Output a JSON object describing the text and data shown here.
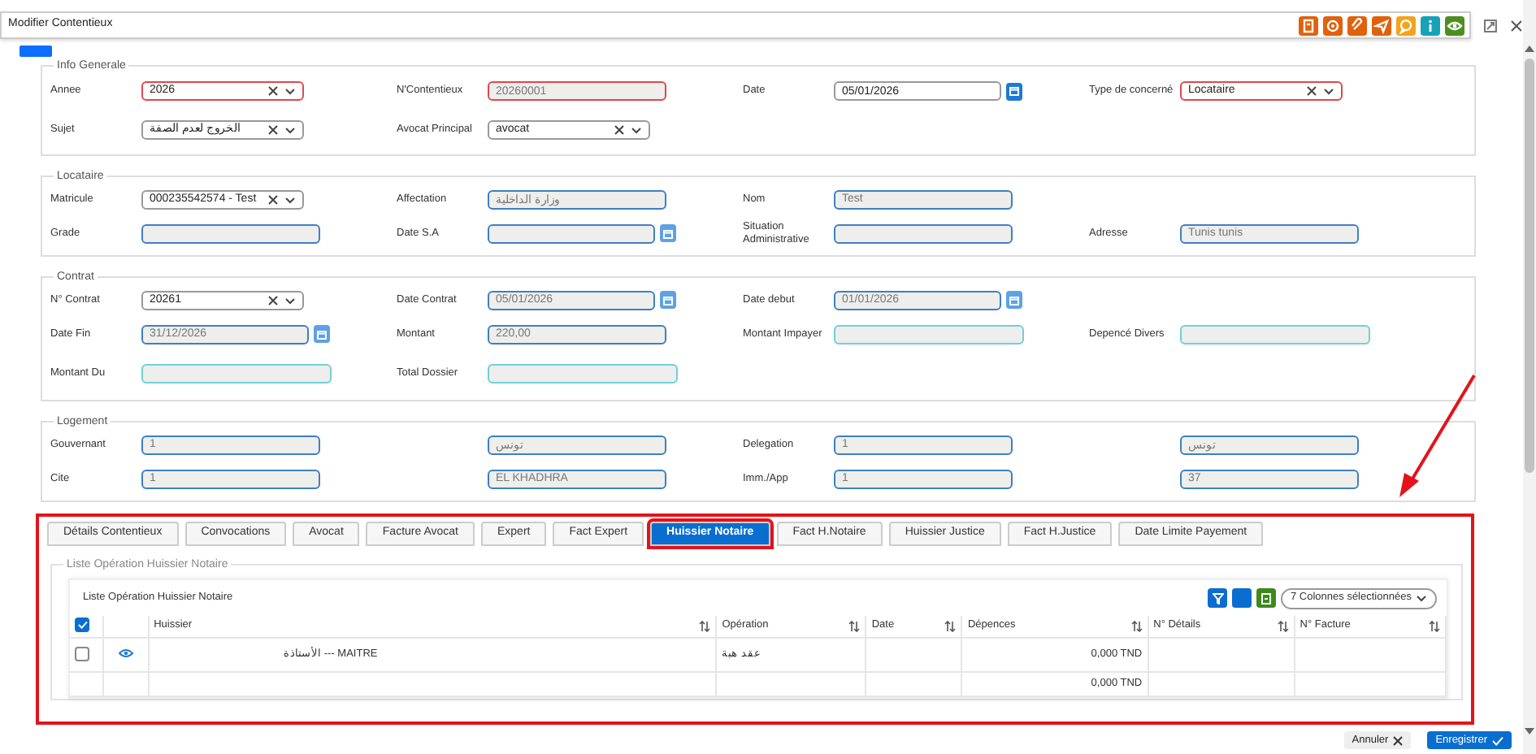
{
  "window": {
    "title": "Modifier Contentieux"
  },
  "sections": [
    {
      "title": "Info Generale",
      "rows": [
        [
          {
            "label": "Annee",
            "kind": "select",
            "value": "2026",
            "invalid": true
          },
          {
            "label": "N'Contentieux",
            "kind": "input",
            "value": "20260001",
            "invalid": true,
            "readonly": true
          },
          {
            "label": "Date",
            "kind": "date",
            "value": "05/01/2026"
          },
          {
            "label": "Type de concerné",
            "kind": "select",
            "value": "Locataire",
            "invalid": true
          }
        ],
        [
          {
            "label": "Sujet",
            "kind": "select",
            "value": "الخروج لعدم الصفة"
          },
          {
            "label": "Avocat Principal",
            "kind": "select",
            "value": "avocat"
          }
        ]
      ]
    },
    {
      "title": "Locataire",
      "rows": [
        [
          {
            "label": "Matricule",
            "kind": "select",
            "value": "000235542574 - Test"
          },
          {
            "label": "Affectation",
            "kind": "input",
            "value": "وزارة الداخلية",
            "readonly": true
          },
          {
            "label": "Nom",
            "kind": "input",
            "value": "Test",
            "readonly": true
          }
        ],
        [
          {
            "label": "Grade",
            "kind": "input",
            "readonly": true
          },
          {
            "label": "Date S.A",
            "kind": "date",
            "readonly": true
          },
          {
            "label": "Situation Administrative",
            "kind": "input",
            "readonly": true
          },
          {
            "label": "Adresse",
            "kind": "input",
            "value": "Tunis tunis",
            "readonly": true
          }
        ]
      ]
    },
    {
      "title": "Contrat",
      "rows": [
        [
          {
            "label": "N° Contrat",
            "kind": "select",
            "value": "20261"
          },
          {
            "label": "Date Contrat",
            "kind": "date",
            "value": "05/01/2026",
            "readonly": true
          },
          {
            "label": "Date debut",
            "kind": "date",
            "value": "01/01/2026",
            "readonly": true
          }
        ],
        [
          {
            "label": "Date Fin",
            "kind": "date",
            "value": "31/12/2026",
            "readonly": true
          },
          {
            "label": "Montant",
            "kind": "input",
            "value": "220,00",
            "readonly": true
          },
          {
            "label": "Montant Impayer",
            "kind": "amount",
            "readonly": true
          },
          {
            "label": "Depencé Divers",
            "kind": "amount",
            "readonly": true
          }
        ],
        [
          {
            "label": "Montant Du",
            "kind": "amount",
            "readonly": true
          },
          {
            "label": "Total Dossier",
            "kind": "amount",
            "readonly": true
          }
        ]
      ]
    },
    {
      "title": "Logement",
      "rows": [
        [
          {
            "label": "Gouvernant",
            "kind": "input",
            "value": "1",
            "readonly": true
          },
          {
            "kind": "input",
            "value": "تونس",
            "readonly": true
          },
          {
            "label": "Delegation",
            "kind": "input",
            "value": "1",
            "readonly": true
          },
          {
            "kind": "input",
            "value": "تونس",
            "readonly": true
          }
        ],
        [
          {
            "label": "Cite",
            "kind": "input",
            "value": "1",
            "readonly": true
          },
          {
            "kind": "input",
            "value": "EL KHADHRA",
            "readonly": true
          },
          {
            "label": "Imm./App",
            "kind": "input",
            "value": "1",
            "readonly": true
          },
          {
            "kind": "input",
            "value": "37",
            "readonly": true
          }
        ]
      ]
    }
  ],
  "panel": {
    "tabs": [
      {
        "label": "Détails Contentieux",
        "selected": false
      },
      {
        "label": "Convocations",
        "selected": false
      },
      {
        "label": "Avocat",
        "selected": false
      },
      {
        "label": "Facture Avocat",
        "selected": false
      },
      {
        "label": "Expert",
        "selected": false
      },
      {
        "label": "Fact Expert",
        "selected": false
      },
      {
        "label": "Huissier Notaire",
        "selected": true
      },
      {
        "label": "Fact H.Notaire",
        "selected": false
      },
      {
        "label": "Huissier Justice",
        "selected": false
      },
      {
        "label": "Fact H.Justice",
        "selected": false
      },
      {
        "label": "Date Limite Payement",
        "selected": false
      }
    ],
    "group_title": "Liste Opération Huissier Notaire",
    "card_title": "Liste Opération Huissier Notaire",
    "column_select": "7 Colonnes sélectionnées",
    "table": {
      "all_checked": true,
      "columns": [
        "Huissier",
        "Opération",
        "Date",
        "Dépences",
        "N° Détails",
        "N° Facture"
      ],
      "rows": [
        {
          "kind": "data",
          "checked": false,
          "cells": [
            "الأستاذة --- MAITRE",
            "عقد هبة",
            "",
            "0,000 TND",
            "",
            ""
          ]
        },
        {
          "kind": "total",
          "cells": [
            "",
            "",
            "",
            "0,000 TND",
            "",
            ""
          ]
        }
      ]
    }
  },
  "footer_buttons": [
    {
      "label": "Annuler",
      "kind": "cancel"
    },
    {
      "label": "Enregistrer",
      "kind": "save"
    }
  ]
}
